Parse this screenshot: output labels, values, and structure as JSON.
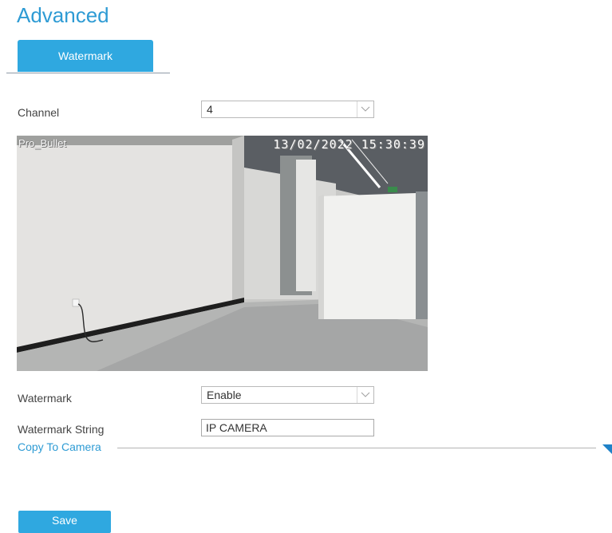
{
  "page": {
    "title": "Advanced"
  },
  "tabs": [
    {
      "label": "Watermark",
      "active": true
    }
  ],
  "channel": {
    "label": "Channel",
    "value": "4"
  },
  "preview": {
    "camera_name": "Pro_Bullet",
    "timestamp": "13/02/2022 15:30:39"
  },
  "watermark": {
    "label": "Watermark",
    "value": "Enable"
  },
  "watermark_string": {
    "label": "Watermark String",
    "value": "IP CAMERA"
  },
  "copy_to_camera": {
    "label": "Copy To Camera"
  },
  "actions": {
    "save_label": "Save"
  },
  "colors": {
    "accent": "#2fa8e0",
    "title": "#2e9bd4"
  }
}
